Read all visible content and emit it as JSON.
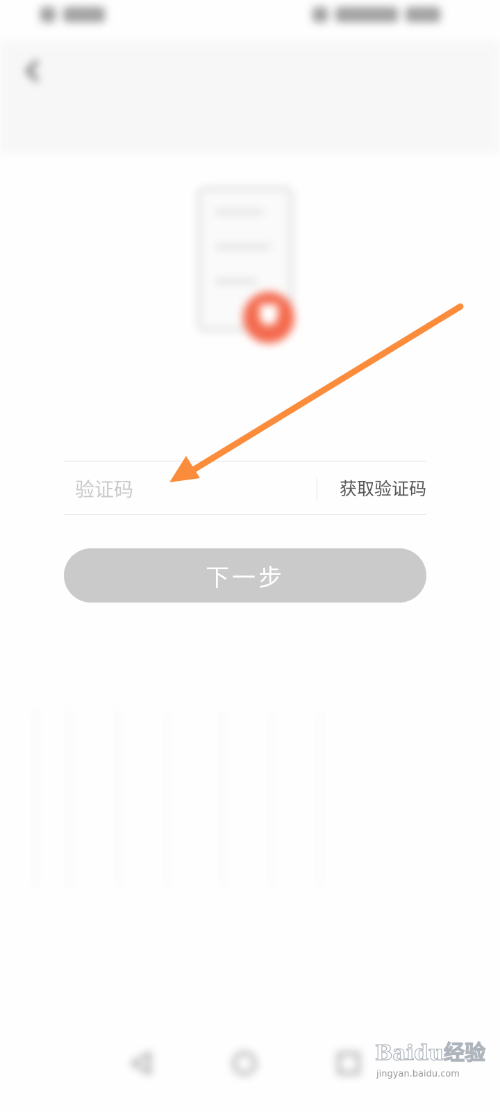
{
  "status_bar": {
    "left_text": "",
    "right_text": ""
  },
  "header": {
    "title": "",
    "back_icon": "chevron-left-icon"
  },
  "illustration": {
    "icon": "phone-shield-icon",
    "accent_color": "#f46a4e"
  },
  "hint": {
    "text": ""
  },
  "form": {
    "phone_number": "",
    "code_placeholder": "验证码",
    "get_code_label": "获取验证码",
    "next_label": "下一步",
    "next_button_color": "#cacaca"
  },
  "footer": {
    "link_text": ""
  },
  "nav_bar": {
    "icons": [
      "back-triangle-icon",
      "home-circle-icon",
      "recents-square-icon"
    ]
  },
  "annotation": {
    "arrow_color": "#fb8c3c"
  },
  "watermark": {
    "brand": "Baidu经验",
    "url": "jingyan.baidu.com"
  }
}
